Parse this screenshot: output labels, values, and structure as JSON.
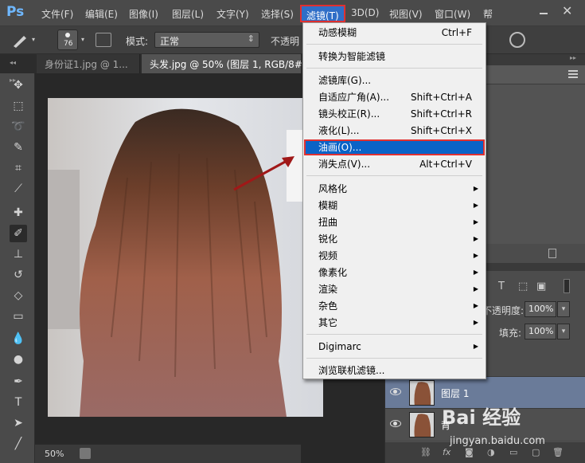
{
  "app": {
    "logo": "Ps"
  },
  "menubar": {
    "items": [
      "文件(F)",
      "编辑(E)",
      "图像(I)",
      "图层(L)",
      "文字(Y)",
      "选择(S)",
      "滤镜(T)",
      "3D(D)",
      "视图(V)",
      "窗口(W)",
      "帮"
    ]
  },
  "options": {
    "brush_size": "76",
    "mode_label": "模式:",
    "mode_value": "正常",
    "opacity_label": "不透明"
  },
  "tabs": [
    {
      "label": "身份证1.jpg @ 1...",
      "active": false
    },
    {
      "label": "头发.jpg @ 50% (图层 1, RGB/8#) *",
      "active": true
    }
  ],
  "status": {
    "zoom": "50%"
  },
  "filter_menu": {
    "items": [
      {
        "label": "动感模糊",
        "shortcut": "Ctrl+F"
      },
      {
        "label": "转换为智能滤镜",
        "shortcut": ""
      },
      {
        "label": "滤镜库(G)...",
        "shortcut": ""
      },
      {
        "label": "自适应广角(A)...",
        "shortcut": "Shift+Ctrl+A"
      },
      {
        "label": "镜头校正(R)...",
        "shortcut": "Shift+Ctrl+R"
      },
      {
        "label": "液化(L)...",
        "shortcut": "Shift+Ctrl+X"
      },
      {
        "label": "油画(O)...",
        "shortcut": "",
        "highlighted": true
      },
      {
        "label": "消失点(V)...",
        "shortcut": "Alt+Ctrl+V"
      },
      {
        "label": "风格化",
        "submenu": true
      },
      {
        "label": "模糊",
        "submenu": true
      },
      {
        "label": "扭曲",
        "submenu": true
      },
      {
        "label": "锐化",
        "submenu": true
      },
      {
        "label": "视频",
        "submenu": true
      },
      {
        "label": "像素化",
        "submenu": true
      },
      {
        "label": "渲染",
        "submenu": true
      },
      {
        "label": "杂色",
        "submenu": true
      },
      {
        "label": "其它",
        "submenu": true
      },
      {
        "label": "Digimarc",
        "submenu": true
      },
      {
        "label": "浏览联机滤镜..."
      }
    ]
  },
  "layers": {
    "opacity_label": "不透明度:",
    "opacity_value": "100%",
    "fill_label": "填充:",
    "fill_value": "100%",
    "rows": [
      {
        "name": "图层 1",
        "selected": true
      },
      {
        "name": "背",
        "selected": false
      }
    ]
  },
  "watermark": {
    "brand": "Bai 经验",
    "url": "jingyan.baidu.com"
  },
  "colors": {
    "highlight": "#0a63c7",
    "annotation_red": "#e03030",
    "arrow": "#a01818"
  }
}
